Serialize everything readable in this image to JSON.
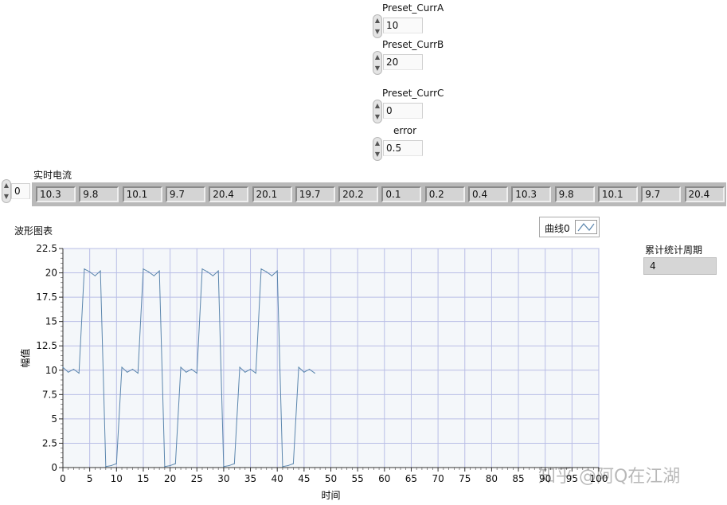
{
  "controls": [
    {
      "label": "Preset_CurrA",
      "value": "10"
    },
    {
      "label": "Preset_CurrB",
      "value": "20"
    },
    {
      "label": "Preset_CurrC",
      "value": "0"
    },
    {
      "label": "error",
      "value": "0.5"
    }
  ],
  "array": {
    "label": "实时电流",
    "index": "0",
    "values": [
      "10.3",
      "9.8",
      "10.1",
      "9.7",
      "20.4",
      "20.1",
      "19.7",
      "20.2",
      "0.1",
      "0.2",
      "0.4",
      "10.3",
      "9.8",
      "10.1",
      "9.7",
      "20.4"
    ]
  },
  "graph": {
    "title": "波形图表",
    "legend_label": "曲线0"
  },
  "period": {
    "label": "累计统计周期",
    "value": "4"
  },
  "watermark": "知乎 @阿Q在江湖",
  "colors": {
    "plot_bg": "#f4f7fa",
    "grid": "#b9bee6",
    "trace": "#5b86ad"
  },
  "chart_data": {
    "type": "line",
    "xlabel": "时间",
    "ylabel": "幅值",
    "xlim": [
      0,
      100
    ],
    "ylim": [
      0,
      22.5
    ],
    "x_ticks": [
      0,
      5,
      10,
      15,
      20,
      25,
      30,
      35,
      40,
      45,
      50,
      55,
      60,
      65,
      70,
      75,
      80,
      85,
      90,
      95,
      100
    ],
    "y_ticks": [
      0,
      2.5,
      5,
      7.5,
      10,
      12.5,
      15,
      17.5,
      20,
      22.5
    ],
    "y_tick_labels": [
      "0",
      "2.5",
      "5",
      "7.5",
      "10",
      "12.5",
      "15",
      "17.5",
      "20",
      "22.5"
    ],
    "grid": true,
    "series": [
      {
        "values": [
          10.3,
          9.8,
          10.1,
          9.7,
          20.4,
          20.1,
          19.7,
          20.2,
          0.1,
          0.2,
          0.4,
          10.3,
          9.8,
          10.1,
          9.7,
          20.4,
          20.1,
          19.7,
          20.2,
          0.1,
          0.2,
          0.4,
          10.3,
          9.8,
          10.1,
          9.7,
          20.4,
          20.1,
          19.7,
          20.2,
          0.1,
          0.2,
          0.4,
          10.3,
          9.8,
          10.1,
          9.7,
          20.4,
          20.1,
          19.7,
          20.2,
          0.1,
          0.2,
          0.4,
          10.3,
          9.8,
          10.1,
          9.7
        ]
      }
    ]
  }
}
